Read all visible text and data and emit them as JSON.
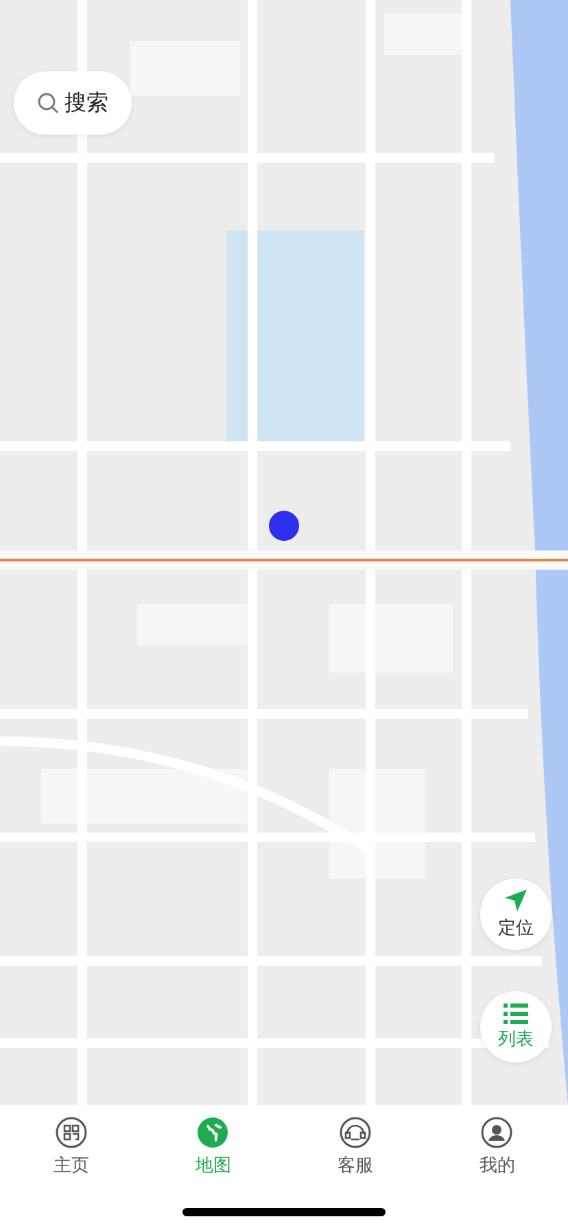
{
  "search": {
    "label": "搜索"
  },
  "map_controls": [
    {
      "kind": "locate",
      "label": "定位"
    },
    {
      "kind": "list",
      "label": "列表"
    }
  ],
  "tabs": [
    {
      "kind": "home",
      "label": "主页",
      "selected": false
    },
    {
      "kind": "map",
      "label": "地图",
      "selected": true
    },
    {
      "kind": "service",
      "label": "客服",
      "selected": false
    },
    {
      "kind": "profile",
      "label": "我的",
      "selected": false
    }
  ]
}
